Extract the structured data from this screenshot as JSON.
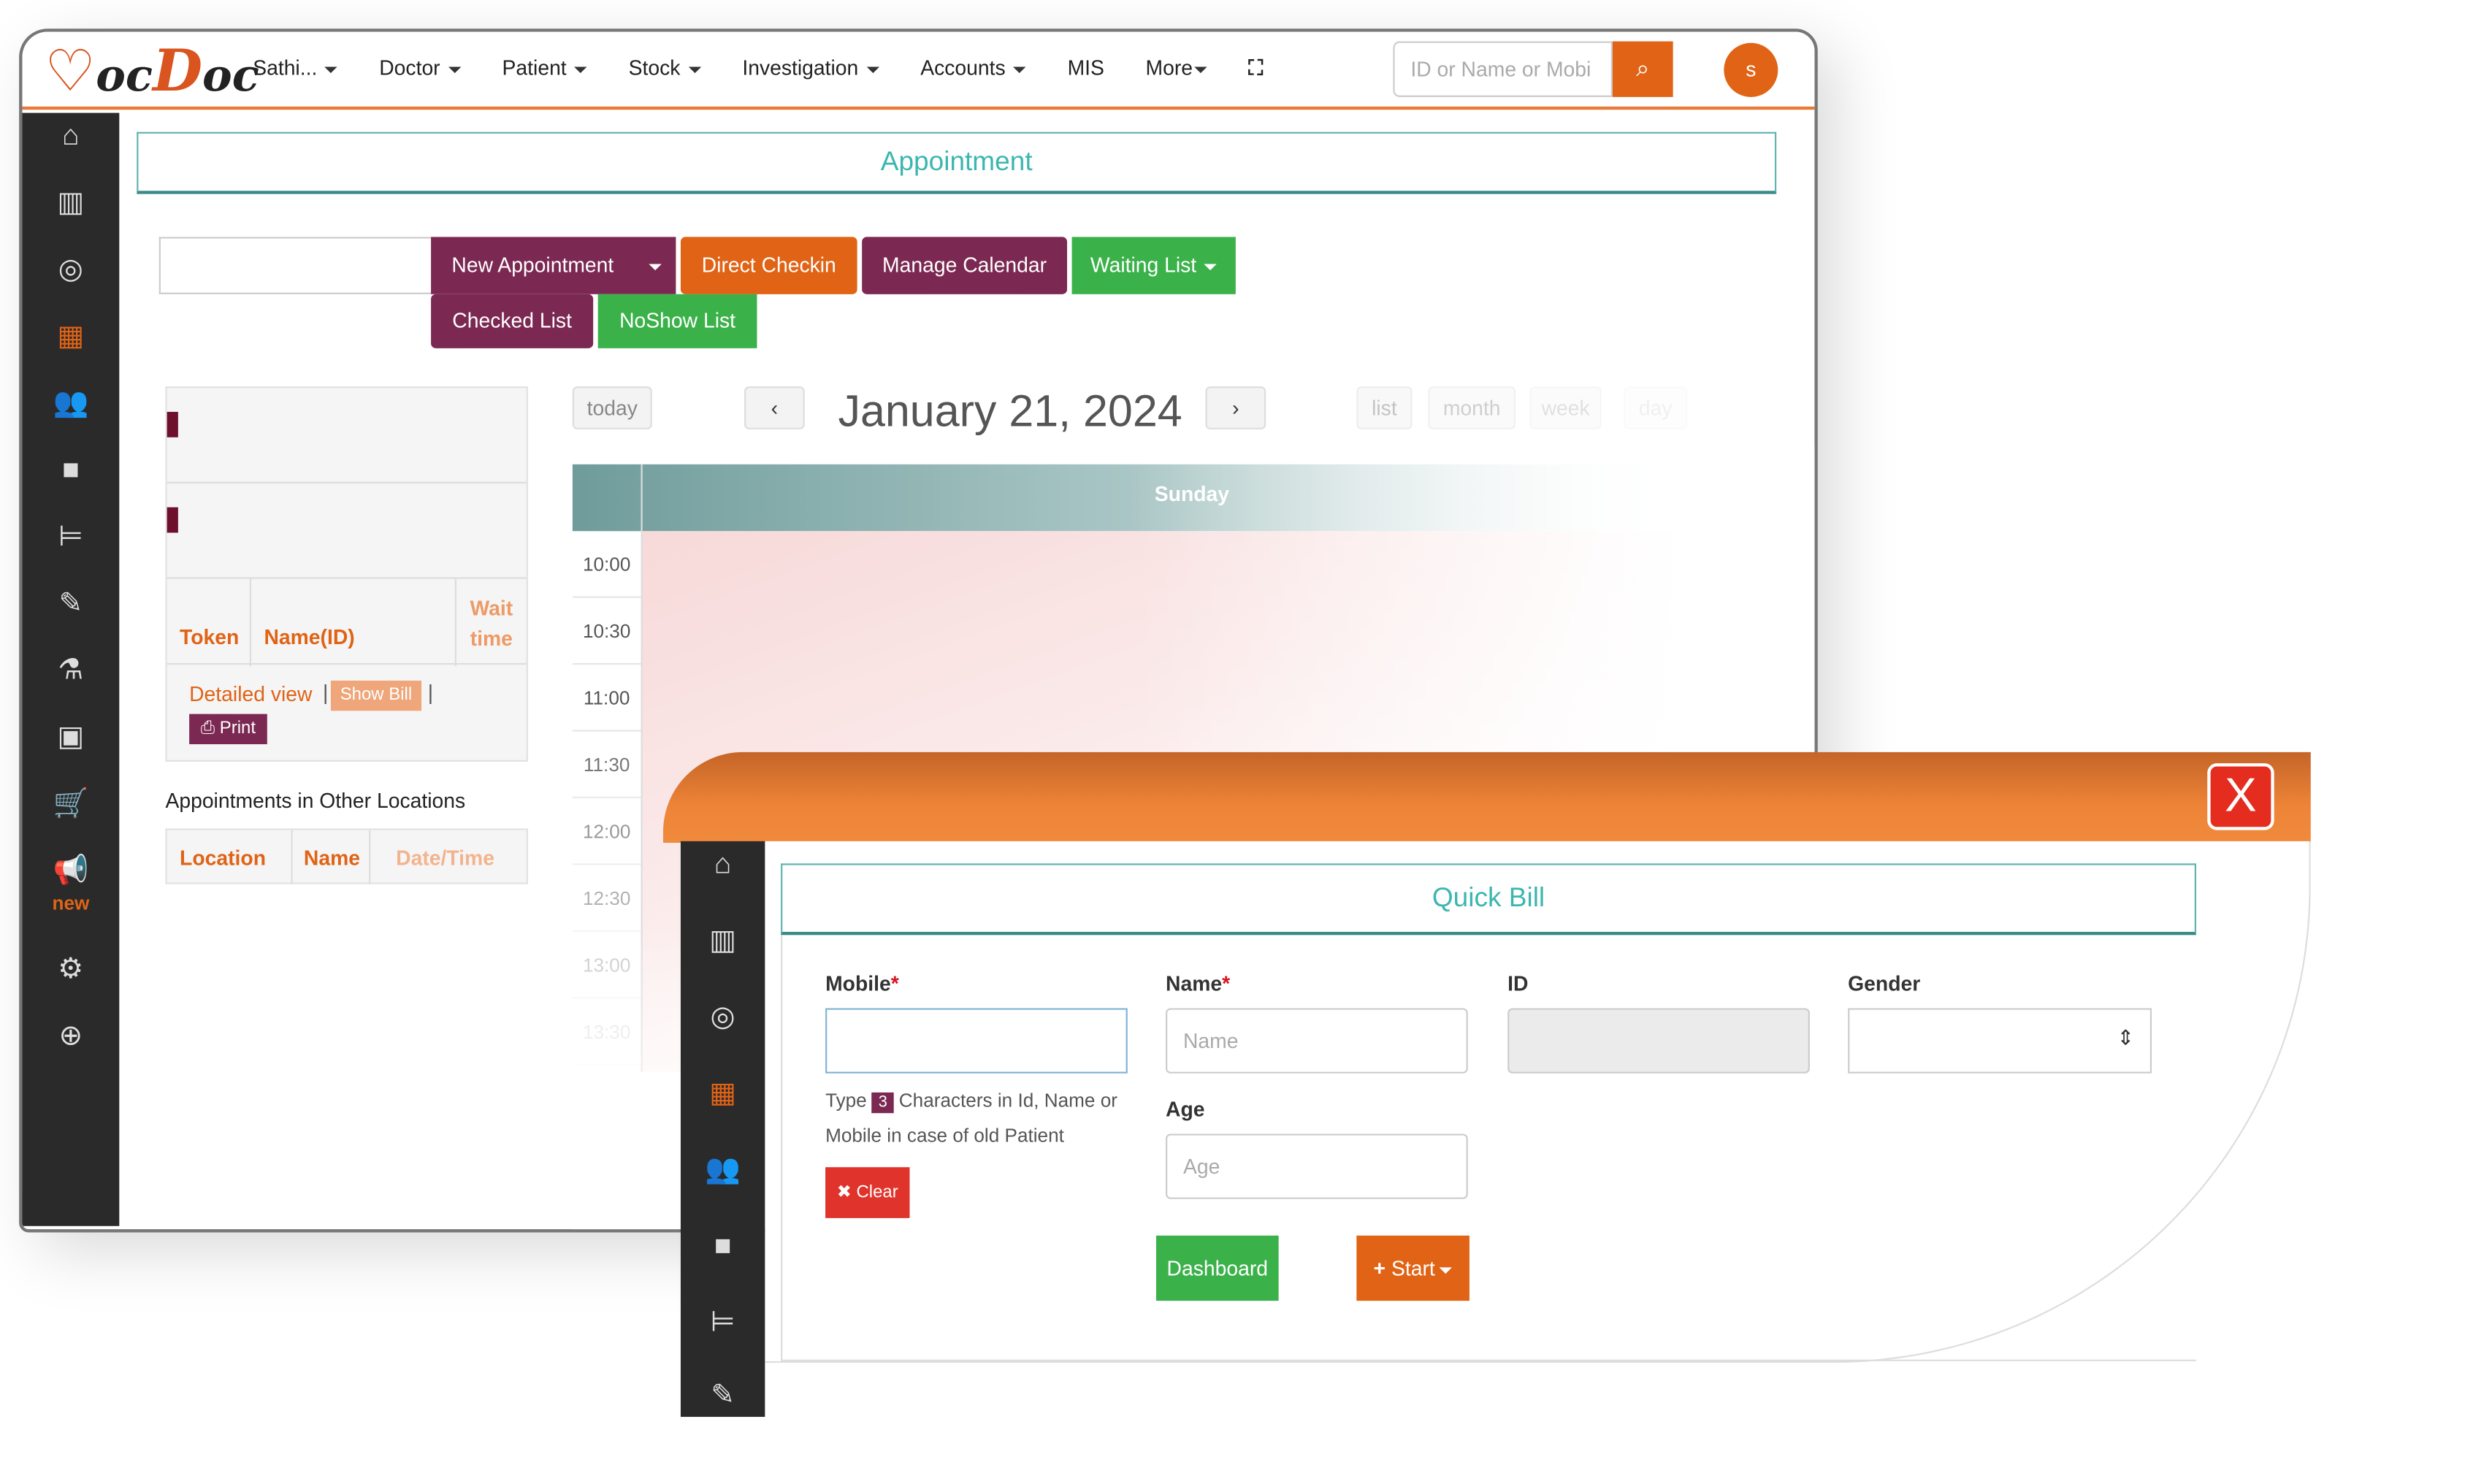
{
  "app": {
    "logo": "DocDoc",
    "brand_color": "#e06316"
  },
  "nav": {
    "items": [
      {
        "label": "Sathi...",
        "dropdown": true
      },
      {
        "label": "Doctor",
        "dropdown": true
      },
      {
        "label": "Patient",
        "dropdown": true
      },
      {
        "label": "Stock",
        "dropdown": true
      },
      {
        "label": "Investigation",
        "dropdown": true
      },
      {
        "label": "Accounts",
        "dropdown": true
      },
      {
        "label": "MIS",
        "dropdown": false
      },
      {
        "label": "More",
        "dropdown": true
      }
    ],
    "search_placeholder": "ID or Name or Mobi",
    "avatar": "s"
  },
  "sidebar": {
    "icons": [
      "home-icon",
      "bar-chart-icon",
      "target-icon",
      "calendar-icon",
      "users-icon",
      "video-icon",
      "bed-icon",
      "edit-icon",
      "flask-icon",
      "image-icon",
      "cart-icon",
      "megaphone-icon",
      "gear-icon",
      "lifebuoy-icon"
    ],
    "new_label": "new"
  },
  "appointment": {
    "title": "Appointment",
    "buttons": {
      "new_appointment": "New Appointment",
      "direct_checkin": "Direct Checkin",
      "manage_calendar": "Manage Calendar",
      "waiting_list": "Waiting List",
      "checked_list": "Checked List",
      "noshow_list": "NoShow List"
    },
    "queue_table": {
      "headers": [
        "Token",
        "Name(ID)",
        "Wait time"
      ],
      "detailed_view": "Detailed view",
      "show_bill": "Show Bill",
      "print": "Print"
    },
    "other_locations": {
      "title": "Appointments in Other Locations",
      "headers": [
        "Location",
        "Name",
        "Date/Time"
      ]
    },
    "calendar": {
      "today": "today",
      "date": "January 21, 2024",
      "views": [
        "list",
        "month",
        "week",
        "day"
      ],
      "day_header": "Sunday",
      "times": [
        "10:00",
        "10:30",
        "11:00",
        "11:30",
        "12:00",
        "12:30",
        "13:00",
        "13:30"
      ]
    }
  },
  "quick_bill": {
    "title": "Quick Bill",
    "close": "X",
    "mobile_label": "Mobile",
    "name_label": "Name",
    "id_label": "ID",
    "gender_label": "Gender",
    "age_label": "Age",
    "name_placeholder": "Name",
    "age_placeholder": "Age",
    "hint_pre": "Type",
    "hint_count": "3",
    "hint_post": "Characters in Id, Name or Mobile in case of old Patient",
    "clear": "Clear",
    "dashboard": "Dashboard",
    "start": "Start"
  }
}
